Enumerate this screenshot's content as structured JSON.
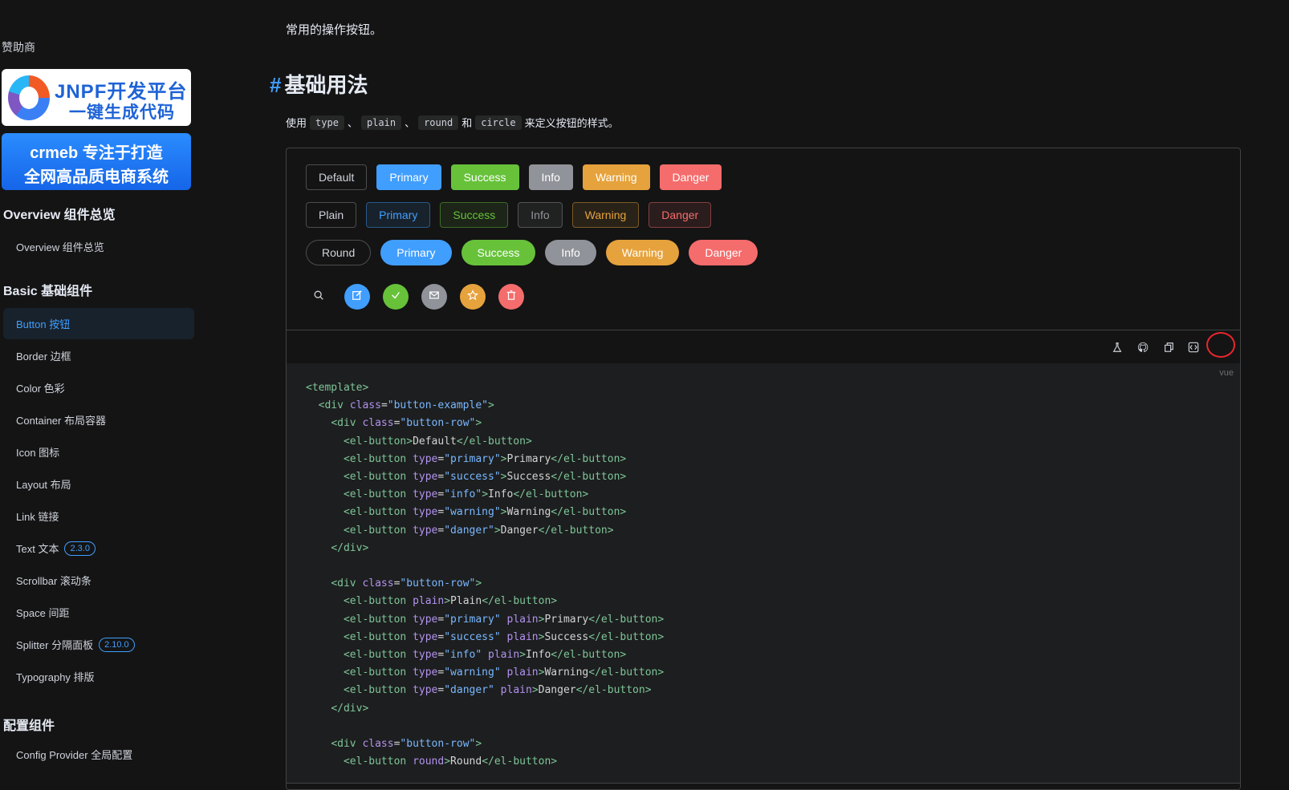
{
  "sidebar": {
    "sponsor_title": "赞助商",
    "ad1": {
      "line1": "JNPF开发平台",
      "line2": "一键生成代码"
    },
    "ad2": {
      "line1": "crmeb 专注于打造",
      "line2": "全网高品质电商系统"
    },
    "groups": [
      {
        "title": "Overview 组件总览",
        "items": [
          {
            "label": "Overview 组件总览"
          }
        ]
      },
      {
        "title": "Basic 基础组件",
        "items": [
          {
            "label": "Button 按钮",
            "active": true
          },
          {
            "label": "Border 边框"
          },
          {
            "label": "Color 色彩"
          },
          {
            "label": "Container 布局容器"
          },
          {
            "label": "Icon 图标"
          },
          {
            "label": "Layout 布局"
          },
          {
            "label": "Link 链接"
          },
          {
            "label": "Text 文本",
            "badge": "2.3.0"
          },
          {
            "label": "Scrollbar 滚动条"
          },
          {
            "label": "Space 间距"
          },
          {
            "label": "Splitter 分隔面板",
            "badge": "2.10.0"
          },
          {
            "label": "Typography 排版"
          }
        ]
      },
      {
        "title": "配置组件",
        "items": [
          {
            "label": "Config Provider 全局配置"
          }
        ]
      }
    ]
  },
  "main": {
    "intro": "常用的操作按钮。",
    "heading_hash": "#",
    "heading": "基础用法",
    "desc": {
      "prefix": "使用",
      "code1": "type",
      "sep1": "、",
      "code2": "plain",
      "sep2": "、",
      "code3": "round",
      "and": "和",
      "code4": "circle",
      "suffix": "来定义按钮的样式。"
    },
    "rows": {
      "basic": [
        "Default",
        "Primary",
        "Success",
        "Info",
        "Warning",
        "Danger"
      ],
      "plain": [
        "Plain",
        "Primary",
        "Success",
        "Info",
        "Warning",
        "Danger"
      ],
      "round": [
        "Round",
        "Primary",
        "Success",
        "Info",
        "Warning",
        "Danger"
      ]
    },
    "circle_icons": [
      "search-icon",
      "edit-icon",
      "check-icon",
      "message-icon",
      "star-icon",
      "delete-icon"
    ],
    "toolbar_icons": [
      "playground-icon",
      "github-icon",
      "copy-icon",
      "view-source-icon"
    ],
    "code_lang": "vue",
    "colors": {
      "primary": "#409eff",
      "success": "#67c23a",
      "info": "#909399",
      "warning": "#e6a23c",
      "danger": "#f56c6c",
      "highlight": "#e8262d"
    }
  }
}
